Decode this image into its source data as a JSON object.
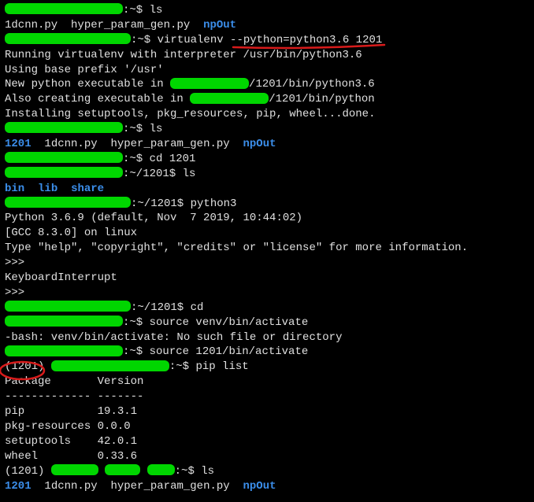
{
  "prompt_home": ":~$",
  "prompt_1201": ":~/1201$",
  "venv_name": "1201",
  "cmd": {
    "ls": "ls",
    "virtualenv": "virtualenv --python=python3.6 1201",
    "cd_1201": "cd 1201",
    "python3": "python3",
    "cd": "cd",
    "source_bad": "source venv/bin/activate",
    "source_good": "source 1201/bin/activate",
    "pip_list": "pip list"
  },
  "files_before": [
    "1dcnn.py",
    "hyper_param_gen.py",
    "npOut"
  ],
  "files_after": [
    "1201",
    "1dcnn.py",
    "hyper_param_gen.py",
    "npOut"
  ],
  "venv_dirs": [
    "bin",
    "lib",
    "share"
  ],
  "virtualenv_output": {
    "l1": "Running virtualenv with interpreter /usr/bin/python3.6",
    "l2": "Using base prefix '/usr'",
    "l3a": "New python executable in ",
    "l3b": "/1201/bin/python3.6",
    "l4a": "Also creating executable in ",
    "l4b": "/1201/bin/python",
    "l5": "Installing setuptools, pkg_resources, pip, wheel...done."
  },
  "python_banner": {
    "l1": "Python 3.6.9 (default, Nov  7 2019, 10:44:02)",
    "l2": "[GCC 8.3.0] on linux",
    "l3": "Type \"help\", \"copyright\", \"credits\" or \"license\" for more information.",
    "prompt": ">>>",
    "interrupt": "KeyboardInterrupt"
  },
  "bash_error": "-bash: venv/bin/activate: No such file or directory",
  "pip_table": {
    "header": "Package       Version",
    "divider": "------------- -------",
    "rows": [
      {
        "pkg": "pip",
        "ver": "19.3.1"
      },
      {
        "pkg": "pkg-resources",
        "ver": "0.0.0"
      },
      {
        "pkg": "setuptools",
        "ver": "42.0.1"
      },
      {
        "pkg": "wheel",
        "ver": "0.33.6"
      }
    ]
  },
  "redact_w": {
    "userhost": "150px",
    "userhost2": "160px",
    "mid": "100px",
    "small": "60px",
    "small2": "45px",
    "tiny": "35px"
  },
  "anno_color": "#d81b1b"
}
